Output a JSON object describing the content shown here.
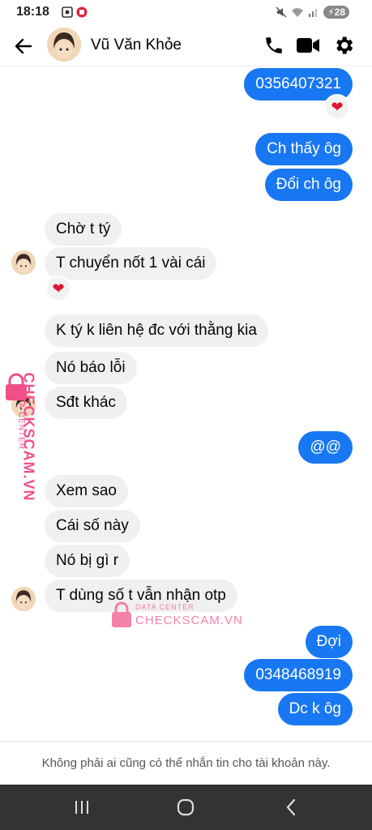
{
  "status_bar": {
    "time": "18:18",
    "battery": "28"
  },
  "header": {
    "contact_name": "Vũ Văn Khỏe"
  },
  "messages": [
    {
      "text": "0356407321",
      "dir": "out"
    },
    {
      "text": "Ch thấy ôg",
      "dir": "out"
    },
    {
      "text": "Đổi ch ôg",
      "dir": "out"
    },
    {
      "text": "Chờ t tý",
      "dir": "in"
    },
    {
      "text": "T chuyển nốt 1 vài cái",
      "dir": "in"
    },
    {
      "text": "K tý k liên hệ đc với thằng kia",
      "dir": "in"
    },
    {
      "text": "Nó báo lỗi",
      "dir": "in"
    },
    {
      "text": "Sđt khác",
      "dir": "in"
    },
    {
      "text": "@@",
      "dir": "out"
    },
    {
      "text": "Xem sao",
      "dir": "in"
    },
    {
      "text": "Cái số này",
      "dir": "in"
    },
    {
      "text": "Nó bị gì r",
      "dir": "in"
    },
    {
      "text": "T dùng số t vẫn nhận otp",
      "dir": "in"
    },
    {
      "text": "Đợi",
      "dir": "out"
    },
    {
      "text": "0348468919",
      "dir": "out"
    },
    {
      "text": "Dc k ôg",
      "dir": "out"
    }
  ],
  "reactions": {
    "emoji": "❤"
  },
  "watermark": {
    "line1": "DATA CENTER",
    "line2": "CHECKSCAM.VN"
  },
  "footer": {
    "note": "Không phải ai cũng có thể nhắn tin cho tài khoản này."
  },
  "colors": {
    "outgoing_bubble": "#1877f2",
    "incoming_bubble": "#f0f0f0",
    "watermark": "#f0508a"
  }
}
